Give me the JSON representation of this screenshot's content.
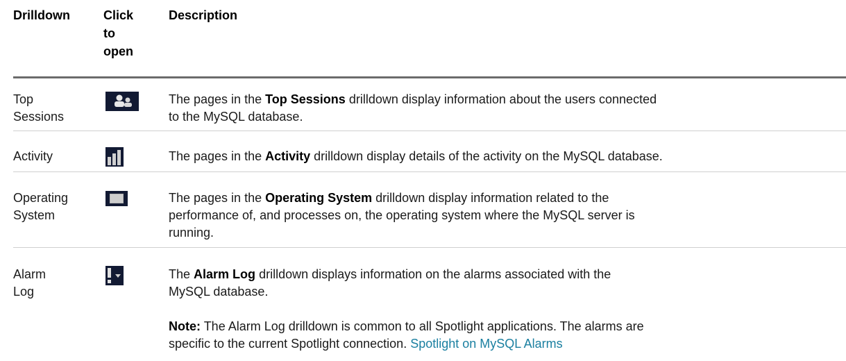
{
  "headers": {
    "drilldown": "Drilldown",
    "click_to_open_lines": [
      "Click",
      "to",
      "open"
    ],
    "description": "Description"
  },
  "rows": [
    {
      "name": "Top Sessions",
      "name_lines": [
        "Top",
        "Sessions"
      ],
      "icon": "users-icon",
      "desc_pre": "The pages in the ",
      "desc_bold": "Top Sessions",
      "desc_lines": [
        "drilldown display information about the users connected",
        "to the MySQL database."
      ]
    },
    {
      "name": "Activity",
      "name_lines": [
        "Activity"
      ],
      "icon": "bar-chart-icon",
      "desc_pre": "The pages in the ",
      "desc_bold": "Activity",
      "desc_lines": [
        "drilldown display details of the activity on the MySQL database."
      ]
    },
    {
      "name": "Operating System",
      "name_lines": [
        "Operating",
        "System"
      ],
      "icon": "monitor-icon",
      "desc_pre": "The pages in the ",
      "desc_bold": "Operating System",
      "desc_lines": [
        "drilldown display information related to the",
        "performance of, and processes on, the operating system where the MySQL server is",
        "running."
      ]
    },
    {
      "name": "Alarm Log",
      "name_lines": [
        "Alarm",
        "Log"
      ],
      "icon": "alarm-dropdown-icon",
      "desc_pre": "The ",
      "desc_bold": "Alarm Log",
      "desc_lines": [
        "drilldown displays information on the alarms associated with the",
        "MySQL database."
      ],
      "note_label": "Note:",
      "note_lines": [
        "The Alarm Log drilldown is common to all Spotlight applications. The alarms are",
        "specific to the current Spotlight connection."
      ],
      "note_link": "Spotlight on MySQL Alarms"
    }
  ],
  "colors": {
    "link": "#1a7fa0",
    "icon_bg": "#121a33",
    "rule": "#6b6b6b"
  }
}
